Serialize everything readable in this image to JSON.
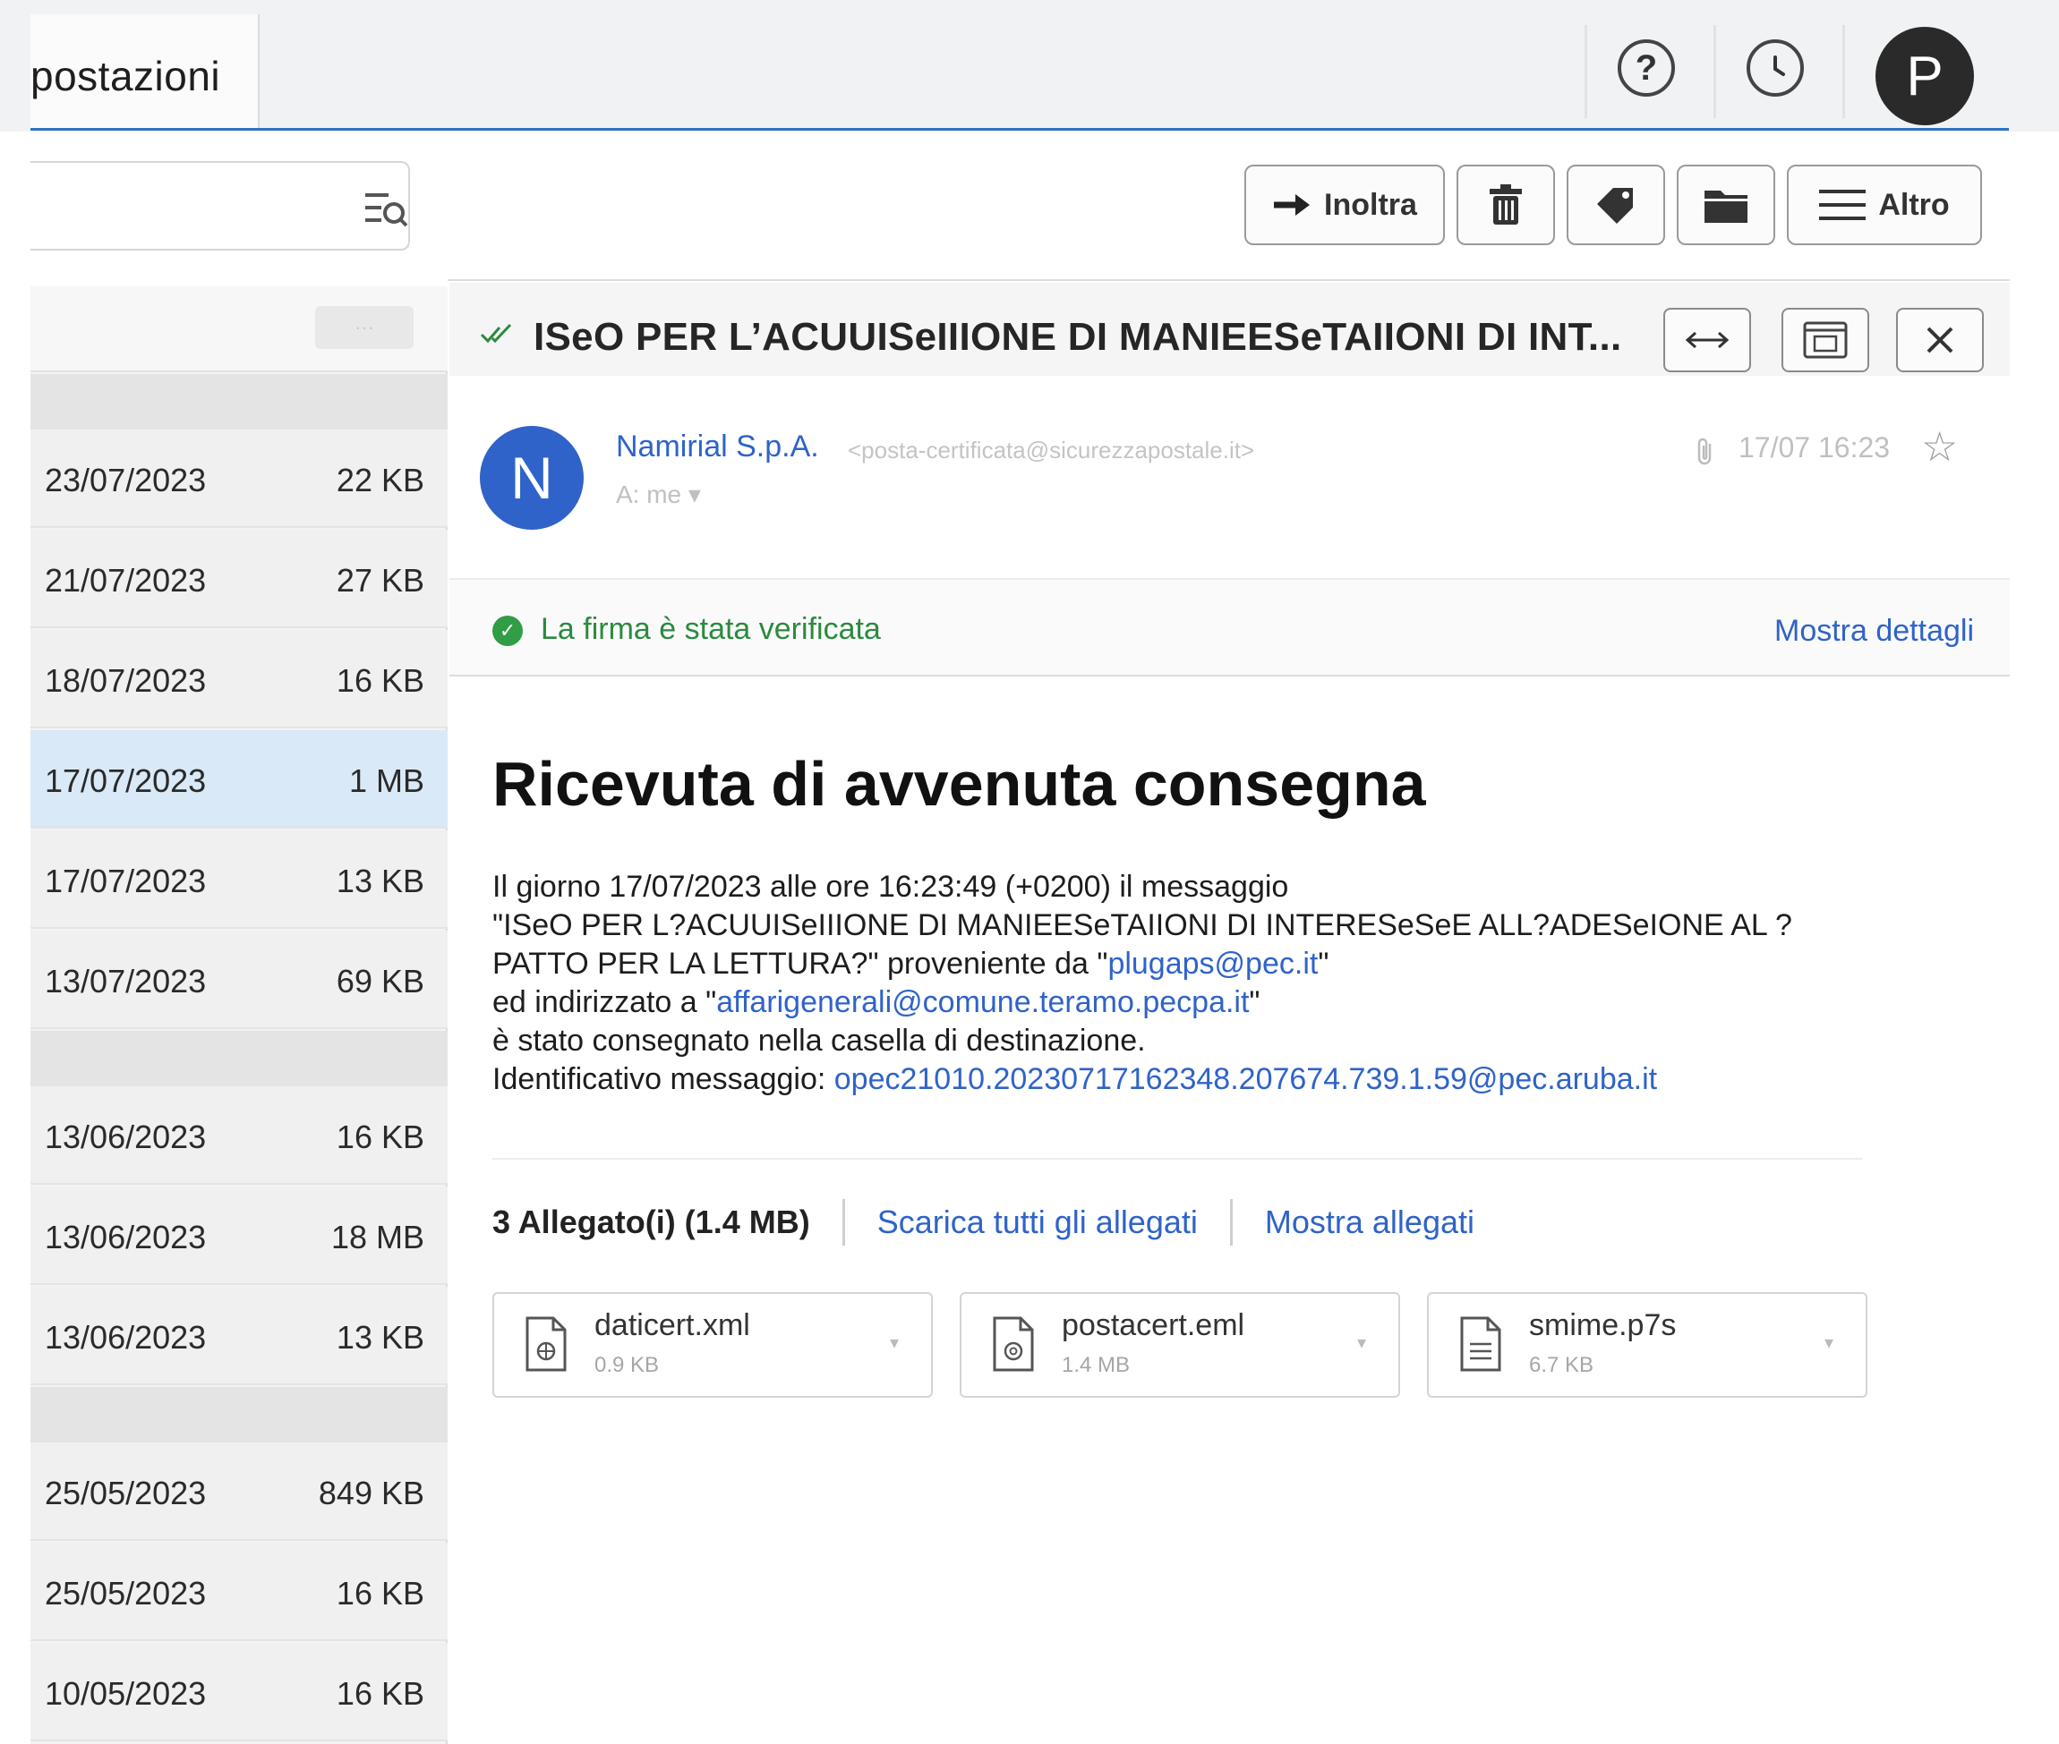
{
  "header": {
    "tab_label": "postazioni",
    "help_label": "?",
    "avatar_initial": "P"
  },
  "icons": {
    "help": "help-icon",
    "history": "history-icon",
    "filter": "filter-search-icon",
    "forward": "arrow-right-icon",
    "trash": "trash-icon",
    "tag": "tag-icon",
    "folder": "folder-icon",
    "more": "menu-icon",
    "verified": "double-check-icon",
    "expand": "expand-horizontal-icon",
    "popout": "popout-window-icon",
    "close": "close-icon",
    "attachment": "paperclip-icon",
    "star": "star-icon",
    "signature_ok": "check-circle-icon",
    "file": "file-icon"
  },
  "search": {
    "value": "",
    "placeholder": ""
  },
  "toolbar": {
    "forward_label": "Inoltra",
    "more_label": "Altro"
  },
  "colors": {
    "accent": "#2b74c6",
    "selected_row": "#d9e9f7",
    "link": "#2f63c9",
    "verified": "#2b8a3e",
    "avatar_sender": "#2f63c9"
  },
  "message_list": {
    "rows": [
      {
        "date": "23/07/2023",
        "size": "22 KB"
      },
      {
        "date": "21/07/2023",
        "size": "27 KB"
      },
      {
        "date": "18/07/2023",
        "size": "16 KB"
      },
      {
        "date": "17/07/2023",
        "size": "1 MB",
        "selected": true
      },
      {
        "date": "17/07/2023",
        "size": "13 KB"
      },
      {
        "date": "13/07/2023",
        "size": "69 KB"
      },
      {
        "date": "13/06/2023",
        "size": "16 KB"
      },
      {
        "date": "13/06/2023",
        "size": "18 MB"
      },
      {
        "date": "13/06/2023",
        "size": "13 KB"
      },
      {
        "date": "25/05/2023",
        "size": "849 KB"
      },
      {
        "date": "25/05/2023",
        "size": "16 KB"
      },
      {
        "date": "10/05/2023",
        "size": "16 KB"
      }
    ]
  },
  "message": {
    "subject": "ISeO PER L’ACUUISeIIIONE DI MANIEESeTAIIONI DI INT...",
    "sender_initial": "N",
    "sender_name": "Namirial S.p.A.",
    "sender_email": "<posta-certificata@sicurezzapostale.it>",
    "recipient": "A: me ▾",
    "date": "17/07 16:23",
    "signature_text": "La firma è stata verificata",
    "signature_details": "Mostra dettagli",
    "body_title": "Ricevuta di avvenuta consegna",
    "body": {
      "line1": "Il giorno 17/07/2023 alle ore 16:23:49 (+0200) il messaggio",
      "line2": "\"ISeO PER L?ACUUISeIIIONE DI MANIEESeTAIIONI DI INTERESeSeE ALL?ADESeIONE AL ?",
      "line3_prefix": "PATTO PER LA LETTURA?\" proveniente da \"",
      "line3_link": "plugaps@pec.it",
      "line3_suffix": "\"",
      "line4_prefix": "ed indirizzato a \"",
      "line4_link": "affarigenerali@comune.teramo.pecpa.it",
      "line4_suffix": "\"",
      "line5": "è stato consegnato nella casella di destinazione.",
      "line6_prefix": "Identificativo messaggio: ",
      "line6_link": "opec21010.20230717162348.207674.739.1.59@pec.aruba.it"
    }
  },
  "attachments": {
    "count_label": "3 Allegato(i) (1.4 MB)",
    "download_all": "Scarica tutti gli allegati",
    "show": "Mostra allegati",
    "files": [
      {
        "name": "daticert.xml",
        "size": "0.9 KB",
        "menu": "▾"
      },
      {
        "name": "postacert.eml",
        "size": "1.4 MB",
        "menu": "▾"
      },
      {
        "name": "smime.p7s",
        "size": "6.7 KB",
        "menu": "▾"
      }
    ]
  }
}
